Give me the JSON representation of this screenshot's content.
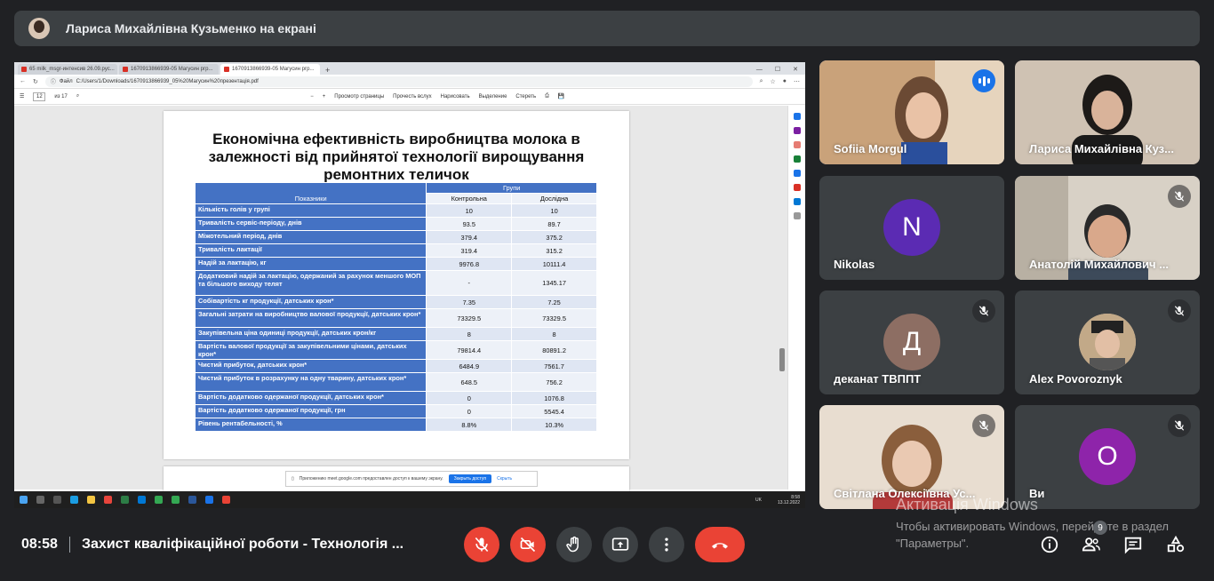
{
  "banner": {
    "text": "Лариса Михайлівна Кузьменко на екрані"
  },
  "browser": {
    "tabs": [
      {
        "label": "65 milk_msgr-интенсив 26.09.рус..."
      },
      {
        "label": "1670913866939-05 Магусин ргр..."
      },
      {
        "label": "1670913866939-05 Магусин ргр..."
      }
    ],
    "url_prefix": "Файл",
    "url": "C:/Users/1/Downloads/1670913866939_05%20Магусин%20презентація.pdf",
    "page_current": "12",
    "page_total": "из 17",
    "toolbar": [
      "Просмотр страницы",
      "Прочесть вслух",
      "Нарисовать",
      "Выделение",
      "Стереть"
    ],
    "notification": {
      "text": "Приложению meet.google.com предоставлен доступ к вашему экрану.",
      "share_btn": "Закрыть доступ",
      "hide_link": "Скрыть"
    },
    "clock_time": "8:58",
    "clock_date": "13.12.2022",
    "tray_lang": "UK"
  },
  "slide": {
    "title": "Економічна ефективність виробництва молока в залежності від прийнятої технології вирощування ремонтних теличок",
    "header_groups": "Групи",
    "header_indicators": "Показники",
    "header_control": "Контрольна",
    "header_experimental": "Дослідна",
    "rows": [
      {
        "label": "Кількість голів у групі",
        "control": "10",
        "experimental": "10"
      },
      {
        "label": "Тривалість сервіс-періоду, днів",
        "control": "93.5",
        "experimental": "89.7"
      },
      {
        "label": "Міжотельний період, днів",
        "control": "379.4",
        "experimental": "375.2"
      },
      {
        "label": "Тривалість лактації",
        "control": "319.4",
        "experimental": "315.2"
      },
      {
        "label": "Надій за лактацію, кг",
        "control": "9976.8",
        "experimental": "10111.4"
      },
      {
        "label": "Додатковий надій за лактацію, одержаний за рахунок меншого МОП та більшого виходу телят",
        "control": "-",
        "experimental": "1345.17"
      },
      {
        "label": "Собівартість кг продукції, датських крон*",
        "control": "7.35",
        "experimental": "7.25"
      },
      {
        "label": "Загальні затрати на виробництво валової продукції, датських крон*",
        "control": "73329.5",
        "experimental": "73329.5"
      },
      {
        "label": "Закупівельна ціна одиниці продукції, датських крон/кг",
        "control": "8",
        "experimental": "8"
      },
      {
        "label": "Вартість валової продукції за закупівельними цінами, датських крон*",
        "control": "79814.4",
        "experimental": "80891.2"
      },
      {
        "label": "Чистий прибуток, датських крон*",
        "control": "6484.9",
        "experimental": "7561.7"
      },
      {
        "label": "Чистий прибуток в розрахунку на одну тварину, датських крон*",
        "control": "648.5",
        "experimental": "756.2"
      },
      {
        "label": "Вартість додатково одержаної продукції, датських крон*",
        "control": "0",
        "experimental": "1076.8"
      },
      {
        "label": "Вартість додатково одержаної продукції, грн",
        "control": "0",
        "experimental": "5545.4"
      },
      {
        "label": "Рівень рентабельності, %",
        "control": "8.8%",
        "experimental": "10.3%"
      }
    ]
  },
  "participants": [
    {
      "name": "Sofiia Morgul",
      "speaking": true
    },
    {
      "name": "Лариса Михайлівна Куз..."
    },
    {
      "name": "Nikolas",
      "initial": "N",
      "color": "#5b2bb3"
    },
    {
      "name": "Анатолій Михайлович ...",
      "muted": true
    },
    {
      "name": "деканат ТВППТ",
      "initial": "Д",
      "color": "#8d6e63",
      "muted": true
    },
    {
      "name": "Alex Povoroznyk",
      "muted": true
    },
    {
      "name": "Світлана Олексіївна Ус...",
      "muted": true
    },
    {
      "name": "Ви",
      "initial": "О",
      "color": "#8e24aa",
      "muted": true
    }
  ],
  "meeting": {
    "time": "08:58",
    "title": "Захист кваліфікаційної роботи - Технологія ...",
    "people_count": "9"
  },
  "watermark": {
    "line1": "Активація Windows",
    "line2": "Чтобы активировать Windows, перейдите в раздел \"Параметры\"."
  },
  "colors": {
    "accent": "#8ab4f8",
    "danger": "#ea4335",
    "table_header": "#4472c4"
  }
}
